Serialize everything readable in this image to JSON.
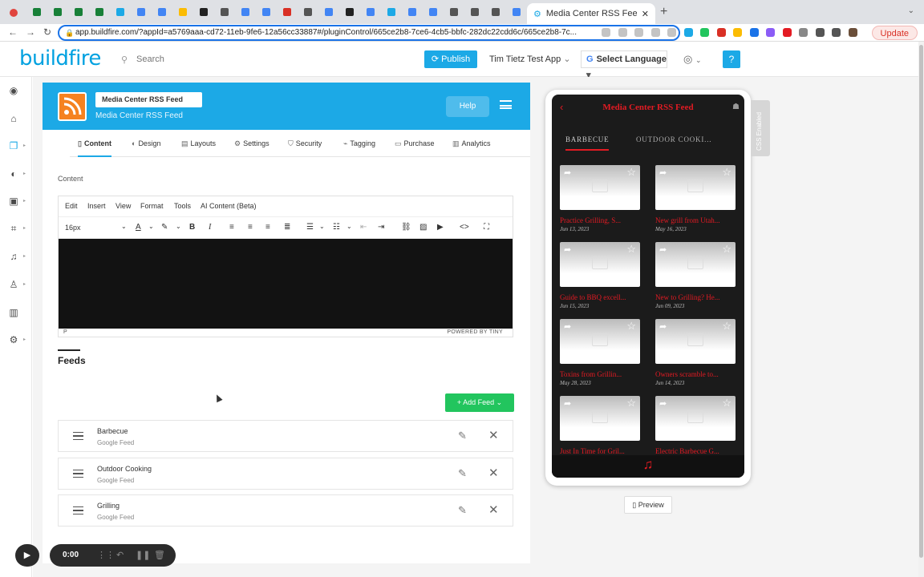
{
  "browser": {
    "active_tab_title": "Media Center RSS Feed - Supp",
    "url": "app.buildfire.com/?appId=a5769aaa-cd72-11eb-9fe6-12a56cc33887#/pluginControl/665ce2b8-7ce6-4cb5-bbfc-282dc22cdd6c/665ce2b8-7c...",
    "update_label": "Update",
    "tab_colors": [
      "#e0443e",
      "#188038",
      "#188038",
      "#188038",
      "#188038",
      "#1ca9e6",
      "#4285f4",
      "#4285f4",
      "#fbbc04",
      "#222222",
      "#555555",
      "#4285f4",
      "#4285f4",
      "#d93025",
      "#555555",
      "#4285f4",
      "#222222",
      "#4285f4",
      "#1ca9e6",
      "#4285f4",
      "#4285f4",
      "#555555",
      "#555555",
      "#555555",
      "#4285f4"
    ]
  },
  "header": {
    "logo": "buildfire",
    "search_placeholder": "Search",
    "publish_label": "Publish",
    "app_name": "Tim Tietz Test App",
    "language_label": "Select Language"
  },
  "plugin": {
    "title_value": "Media Center RSS Feed",
    "subtitle": "Media Center RSS Feed",
    "help_label": "Help",
    "tabs": [
      {
        "label": "Content",
        "icon": "content-icon"
      },
      {
        "label": "Design",
        "icon": "palette-icon"
      },
      {
        "label": "Layouts",
        "icon": "layouts-icon"
      },
      {
        "label": "Settings",
        "icon": "gear-icon"
      },
      {
        "label": "Security",
        "icon": "shield-icon"
      },
      {
        "label": "Tagging",
        "icon": "tag-icon"
      },
      {
        "label": "Purchase",
        "icon": "card-icon"
      },
      {
        "label": "Analytics",
        "icon": "chart-icon"
      }
    ],
    "content_label": "Content",
    "editor": {
      "menu": [
        "Edit",
        "Insert",
        "View",
        "Format",
        "Tools",
        "AI Content (Beta)"
      ],
      "font_size": "16px",
      "status_element": "P",
      "powered_by": "POWERED BY TINY"
    },
    "feeds_title": "Feeds",
    "add_feed_label": "Add Feed",
    "feeds": [
      {
        "name": "Barbecue",
        "type": "Google Feed"
      },
      {
        "name": "Outdoor Cooking",
        "type": "Google Feed"
      },
      {
        "name": "Grilling",
        "type": "Google Feed"
      }
    ]
  },
  "preview": {
    "screen_title": "Media Center RSS Feed",
    "tabs": [
      "BARBECUE",
      "OUTDOOR COOKI..."
    ],
    "cards": [
      {
        "title": "Practice Grilling, S...",
        "date": "Jun 13, 2023"
      },
      {
        "title": "New grill from Utah...",
        "date": "May 16, 2023"
      },
      {
        "title": "Guide to BBQ excell...",
        "date": "Jun 15, 2023"
      },
      {
        "title": "New to Grilling? He...",
        "date": "Jun 09, 2023"
      },
      {
        "title": "Toxins from Grillin...",
        "date": "May 28, 2023"
      },
      {
        "title": "Owners scramble to...",
        "date": "Jun 14, 2023"
      },
      {
        "title": "Just In Time for Gril...",
        "date": ""
      },
      {
        "title": "Electric Barbecue G...",
        "date": ""
      }
    ],
    "css_badge": "CSS Enabled",
    "preview_label": "Preview",
    "accent_color": "#e31b23"
  },
  "recorder": {
    "time": "0:00"
  }
}
